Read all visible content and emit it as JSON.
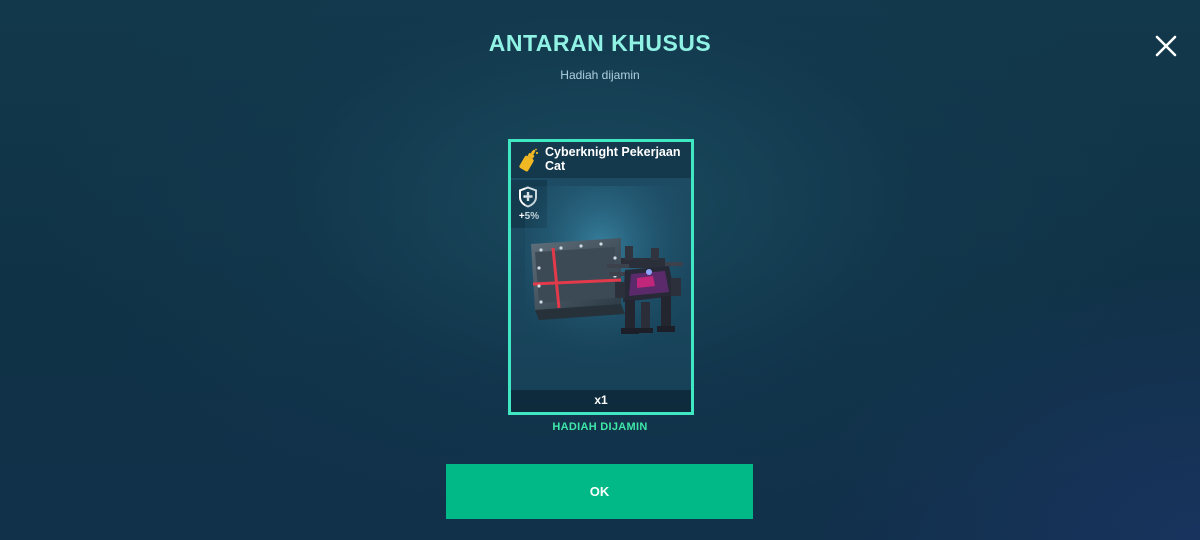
{
  "header": {
    "title": "ANTARAN KHUSUS",
    "subtitle": "Hadiah dijamin"
  },
  "close_icon": "close-icon",
  "reward_card": {
    "item_name": "Cyberknight Pekerjaan Cat",
    "item_type_icon": "paint-spray-icon",
    "bonus_icon": "shield-plus-icon",
    "bonus_value": "+5%",
    "quantity": "x1",
    "border_color": "#3fe7c2"
  },
  "guaranteed_label": "HADIAH DIJAMIN",
  "ok_button": {
    "label": "OK",
    "color": "#00b986"
  },
  "colors": {
    "title": "#8ff2e4",
    "accent_green": "#3fe7a8"
  }
}
